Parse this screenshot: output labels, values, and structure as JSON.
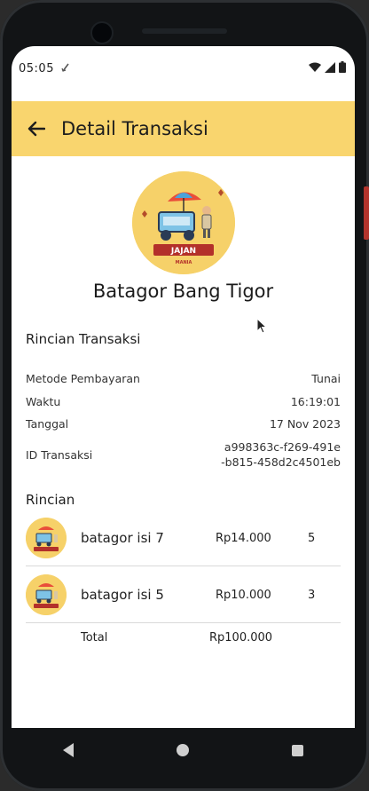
{
  "status": {
    "time": "05:05",
    "sync_icon": "sync-icon",
    "wifi_icon": "wifi-icon",
    "signal_icon": "signal-icon",
    "battery_icon": "battery-icon"
  },
  "appbar": {
    "title": "Detail Transaksi",
    "back_icon": "arrow-left-icon",
    "bg_color": "#f9d56e"
  },
  "store": {
    "name": "Batagor Bang Tigor",
    "logo_text_1": "JAJAN",
    "logo_text_2": "MANIA"
  },
  "transaction": {
    "section_title": "Rincian Transaksi",
    "rows": [
      {
        "label": "Metode Pembayaran",
        "value": "Tunai"
      },
      {
        "label": "Waktu",
        "value": "16:19:01"
      },
      {
        "label": "Tanggal",
        "value": "17 Nov 2023"
      },
      {
        "label": "ID Transaksi",
        "value_line1": "a998363c-f269-491e",
        "value_line2": "-b815-458d2c4501eb"
      }
    ]
  },
  "details": {
    "section_title": "Rincian",
    "items": [
      {
        "name": "batagor isi 7",
        "price": "Rp14.000",
        "qty": "5"
      },
      {
        "name": "batagor isi 5",
        "price": "Rp10.000",
        "qty": "3"
      }
    ],
    "total_label": "Total",
    "total_value": "Rp100.000"
  }
}
